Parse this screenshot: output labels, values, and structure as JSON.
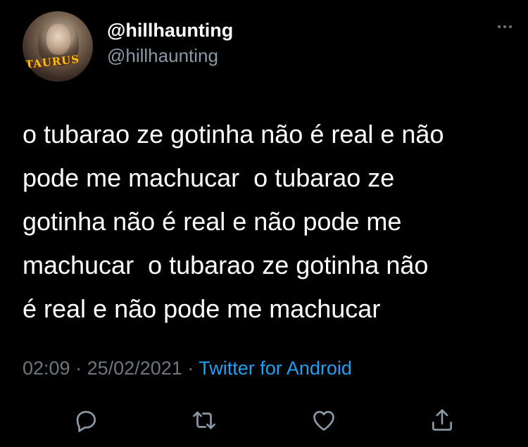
{
  "tweet": {
    "avatar_badge": "TAURUS",
    "display_name": "@hillhaunting",
    "handle": "@hillhaunting",
    "text": "o tubarao ze gotinha não é real e não\npode me machucar  o tubarao ze\ngotinha não é real e não pode me\nmachucar  o tubarao ze gotinha não\né real e não pode me machucar",
    "time": "02:09",
    "date": "25/02/2021",
    "separator": "·",
    "source": "Twitter for Android"
  },
  "actions": {
    "reply_icon": "reply-icon",
    "retweet_icon": "retweet-icon",
    "like_icon": "heart-icon",
    "share_icon": "share-icon"
  },
  "colors": {
    "background": "#000000",
    "text": "#ffffff",
    "secondary": "#6e767d",
    "link": "#1da1f2"
  }
}
